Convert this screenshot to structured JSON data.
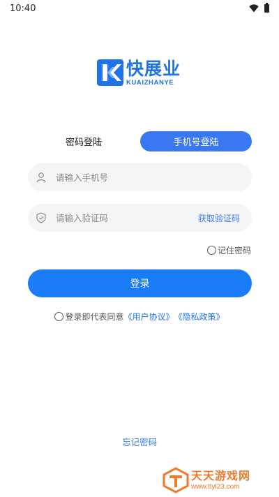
{
  "status_bar": {
    "time": "10:40",
    "icons": [
      "wifi-icon",
      "battery-icon"
    ]
  },
  "logo": {
    "name_cn": "快展业",
    "name_en": "KUAIZHANYE",
    "icon": "kzy-logo-icon",
    "color": "#1f73e6"
  },
  "tabs": [
    {
      "label": "密码登陆",
      "active": false
    },
    {
      "label": "手机号登陆",
      "active": true
    }
  ],
  "phone_field": {
    "placeholder": "请输入手机号",
    "value": "",
    "icon": "user-icon"
  },
  "code_field": {
    "placeholder": "请输入验证码",
    "value": "",
    "icon": "shield-icon",
    "get_code_label": "获取验证码"
  },
  "remember": {
    "label": "记住密码",
    "checked": false
  },
  "login_button": {
    "label": "登录",
    "color": "#1a7cf6"
  },
  "agreement": {
    "prefix": "登录即代表同意",
    "user_agreement": "《用户协议》",
    "privacy_policy": "《隐私政策》",
    "checked": false
  },
  "forgot_password": "忘记密码",
  "watermark": {
    "name": "天天游戏网",
    "url": "www.ttyl23.com",
    "color": "#f07a2a"
  },
  "accent_color": "#3a78f2"
}
